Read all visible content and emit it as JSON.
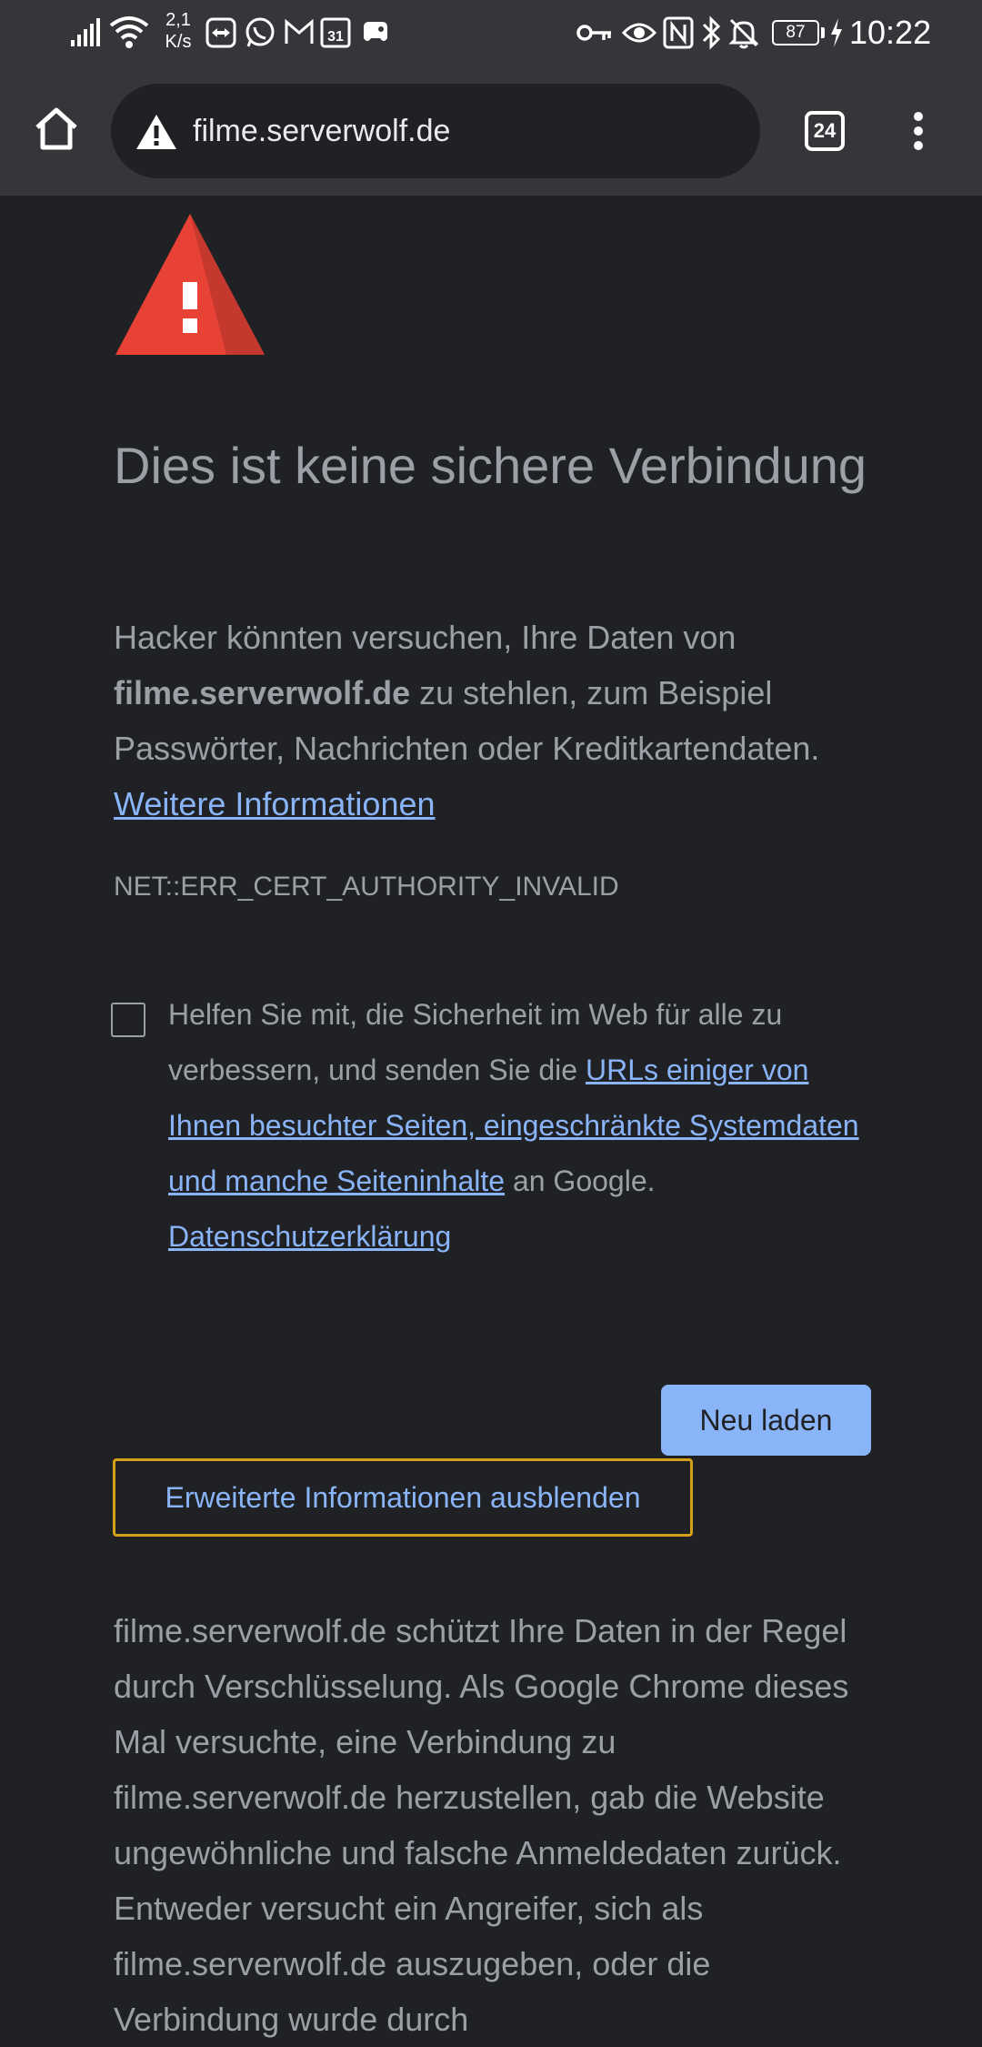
{
  "status_bar": {
    "net_speed_value": "2,1",
    "net_speed_unit": "K/s",
    "battery_level": "87",
    "time": "10:22",
    "icons_left": [
      "signal-icon",
      "wifi-icon",
      "teamviewer-icon",
      "whatsapp-icon",
      "gmail-icon",
      "calendar-icon",
      "game-controller-icon"
    ],
    "icons_right": [
      "vpn-key-icon",
      "eye-icon",
      "nfc-icon",
      "bluetooth-icon",
      "mute-icon",
      "battery-icon",
      "charging-icon"
    ]
  },
  "browser": {
    "url": "filme.serverwolf.de",
    "tab_count": "24"
  },
  "interstitial": {
    "heading": "Dies ist keine sichere Verbindung",
    "explanation_part1": "Hacker könnten versuchen, Ihre Daten von ",
    "explanation_domain": "filme.serverwolf.de",
    "explanation_part2": " zu stehlen, zum Beispiel Passwörter, Nachrichten oder Kreditkartendaten. ",
    "learn_more_link": "Weitere Informationen",
    "error_code": "NET::ERR_CERT_AUTHORITY_INVALID",
    "optin_part1": "Helfen Sie mit, die Sicherheit im Web für alle zu verbessern, und senden Sie die ",
    "optin_link": "URLs einiger von Ihnen besuchter Seiten, eingeschränkte Systemdaten und manche Seiteninhalte",
    "optin_part2": " an Google. ",
    "privacy_link": "Datenschutzerklärung",
    "reload_button": "Neu laden",
    "details_button": "Erweiterte Informationen ausblenden",
    "details_text": "filme.serverwolf.de schützt Ihre Daten in der Regel durch Verschlüsselung. Als Google Chrome dieses Mal versuchte, eine Verbindung zu filme.serverwolf.de herzustellen, gab die Website ungewöhnliche und falsche Anmeldedaten zurück. Entweder versucht ein Angreifer, sich als filme.serverwolf.de auszugeben, oder die Verbindung wurde durch"
  },
  "colors": {
    "background": "#202124",
    "toolbar": "#35363a",
    "link": "#8ab4f8",
    "text": "#9aa0a6",
    "warning_red": "#e74235",
    "focus_ring": "#d4a017"
  }
}
